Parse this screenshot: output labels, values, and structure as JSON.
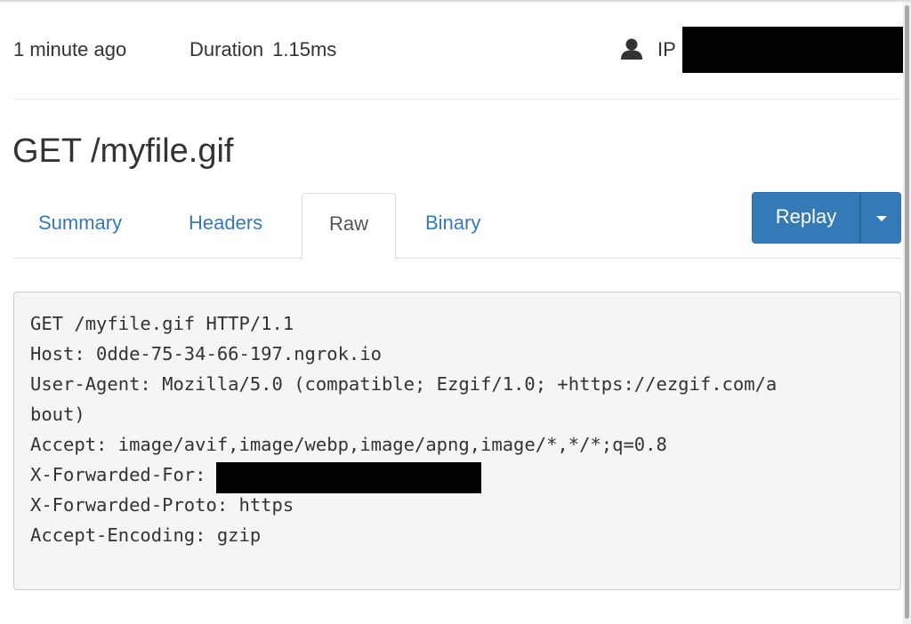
{
  "meta": {
    "time_ago": "1 minute ago",
    "duration_label": "Duration",
    "duration_value": "1.15ms",
    "ip_label": "IP",
    "user_icon": "user-icon"
  },
  "request": {
    "title": "GET /myfile.gif"
  },
  "tabs": [
    {
      "label": "Summary",
      "active": false
    },
    {
      "label": "Headers",
      "active": false
    },
    {
      "label": "Raw",
      "active": true
    },
    {
      "label": "Binary",
      "active": false
    }
  ],
  "replay": {
    "label": "Replay",
    "caret_icon": "chevron-down-icon",
    "color": "#337ab7"
  },
  "raw": {
    "lines": [
      "GET /myfile.gif HTTP/1.1",
      "Host: 0dde-75-34-66-197.ngrok.io",
      "User-Agent: Mozilla/5.0 (compatible; Ezgif/1.0; +https://ezgif.com/a",
      "bout)",
      "Accept: image/avif,image/webp,image/apng,image/*,*/*;q=0.8",
      "X-Forwarded-For:",
      "X-Forwarded-Proto: https",
      "Accept-Encoding: gzip"
    ]
  },
  "colors": {
    "link": "#337ab7",
    "text": "#333333",
    "raw_background": "#f5f5f5"
  }
}
